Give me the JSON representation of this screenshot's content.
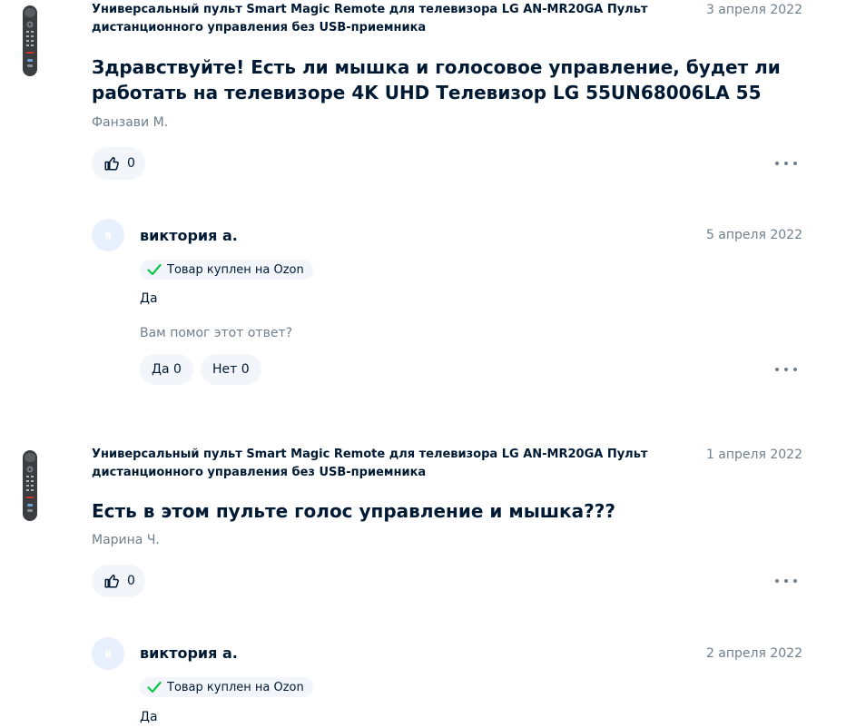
{
  "questions": [
    {
      "product": "Универсальный пульт Smart Magic Remote для телевизора LG AN-MR20GA Пульт дистанционного управления без USB-приемника",
      "date": "3 апреля 2022",
      "text": "Здравствуйте! Есть ли мышка и голосовое управление, будет ли работать на телевизоре 4K UHD Телевизор LG 55UN68006LA 55",
      "author": "Фанзави М.",
      "likes": "0",
      "answer": {
        "avatar_letter": "в",
        "author": "виктория а.",
        "date": "5 апреля 2022",
        "badge": "Товар куплен на Ozon",
        "text": "Да",
        "helpful_prompt": "Вам помог этот ответ?",
        "yes_label": "Да",
        "yes_count": "0",
        "no_label": "Нет",
        "no_count": "0"
      }
    },
    {
      "product": "Универсальный пульт Smart Magic Remote для телевизора LG AN-MR20GA Пульт дистанционного управления без USB-приемника",
      "date": "1 апреля 2022",
      "text": "Есть в этом пульте голос управление и мышка???",
      "author": "Марина Ч.",
      "likes": "0",
      "answer": {
        "avatar_letter": "в",
        "author": "виктория а.",
        "date": "2 апреля 2022",
        "badge": "Товар куплен на Ozon",
        "text": "Да"
      }
    }
  ],
  "colors": {
    "text": "#001a34",
    "muted": "#707f8d",
    "chip_bg": "#f2f5f9",
    "check_green": "#10c44c",
    "avatar_bg": "#e8f0fe"
  },
  "icons": {
    "like": "thumbs-up-icon",
    "more": "more-dots-icon",
    "check": "check-icon",
    "product": "remote-thumbnail"
  }
}
